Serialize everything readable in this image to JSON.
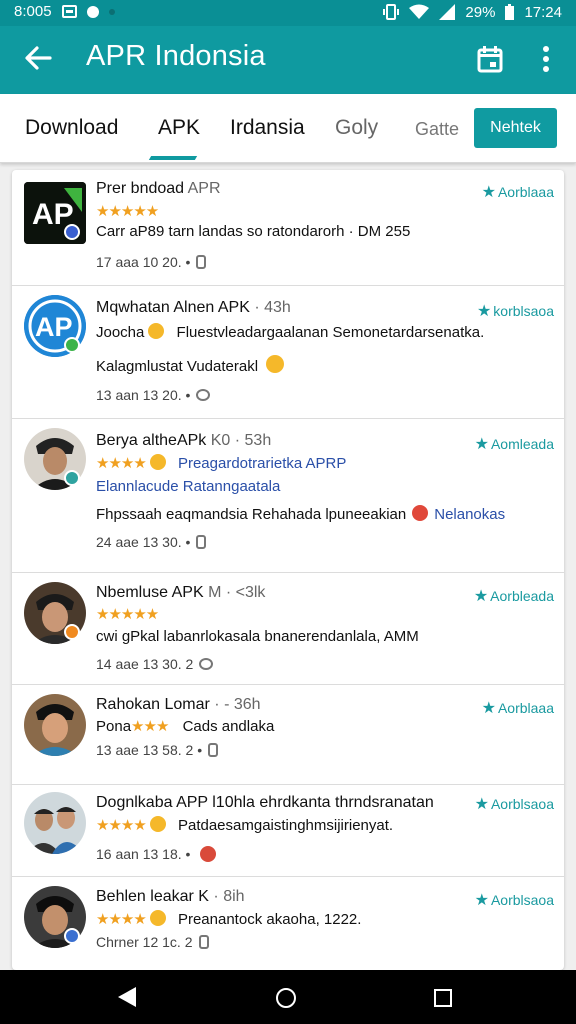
{
  "status_bar": {
    "time_left": "8:005",
    "battery": "29%",
    "time_right": "17:24"
  },
  "app_bar": {
    "title": "APR Indonsia",
    "back_icon": "arrow-left-icon",
    "action_icon": "calendar-icon",
    "menu_icon": "more-vert-icon"
  },
  "tabs": {
    "items": [
      "Download",
      "APK",
      "Irdansia",
      "Goly",
      "Gatte"
    ],
    "selected": "APK",
    "action_button": "Nehtek"
  },
  "colors": {
    "primary": "#0f9aa0",
    "accent": "#109ba1",
    "star": "#f0a020",
    "link": "#2a4fa8"
  },
  "reviews": [
    {
      "avatar": "AP",
      "name": "Prer bndoad",
      "name_suffix": "APR",
      "badge": "Aorblaaa",
      "stars": "★★★★★",
      "line1": "Carr aP89 tarn landas so ratondarorh · DM 255",
      "meta": "17 aaa 10 20. •"
    },
    {
      "avatar": "AP",
      "name": "Mqwhatan Alnen APK",
      "name_suffix": "· 43h",
      "badge": "korblsaoa",
      "line1": "Joocha",
      "line1b": "Fluestvleadargaalanan Semonetardarsenatka.",
      "line2": "Kalagmlustat Vudaterakl",
      "meta": "13 aan 13 20. •"
    },
    {
      "avatar": "person",
      "name": "Berya altheAPk",
      "name_suffix": "K0 · 53h",
      "badge": "Aomleada",
      "stars": "★★★★",
      "line1_blue": "Preagardotrarietka APRP",
      "line2_blue": "Elannlacude",
      "line2_blue_b": "Ratanngaatala",
      "line3": "Fhpssaah eaqmandsia Rehahada lpuneeakian",
      "line3_blue": "Nelanokas",
      "meta": "24 aae 13 30. •"
    },
    {
      "avatar": "person",
      "name": "Nbemluse APK",
      "name_suffix": "M · <3lk",
      "badge": "Aorbleada",
      "stars": "★★★★★",
      "line1": "cwi gPkal labanrlokasala bnanerendanlala, AMM",
      "meta": "14 aae 13 30. 2"
    },
    {
      "avatar": "person",
      "name": "Rahokan Lomar",
      "name_suffix": "· - 36h",
      "badge": "Aorblaaa",
      "line1": "Pona",
      "stars": "★★★",
      "line1b": "Cads andlaka",
      "meta": "13 aae 13 58. 2 •"
    },
    {
      "avatar": "group",
      "name": "Dognlkaba APP",
      "name_suffix": "l10hla ehrdkanta thrndsranatan",
      "badge": "Aorblsaoa",
      "stars": "★★★★",
      "line1": "Patdaesamgaistinghmsijirienyat.",
      "meta": "16 aan 13 18. •"
    },
    {
      "avatar": "person",
      "name": "Behlen leakar K",
      "name_suffix": "· 8ih",
      "badge": "Aorblsaoa",
      "stars": "★★★★",
      "line1": "Preanantock akaoha, 1222.",
      "meta": "Chrner 12 1c. 2"
    }
  ]
}
